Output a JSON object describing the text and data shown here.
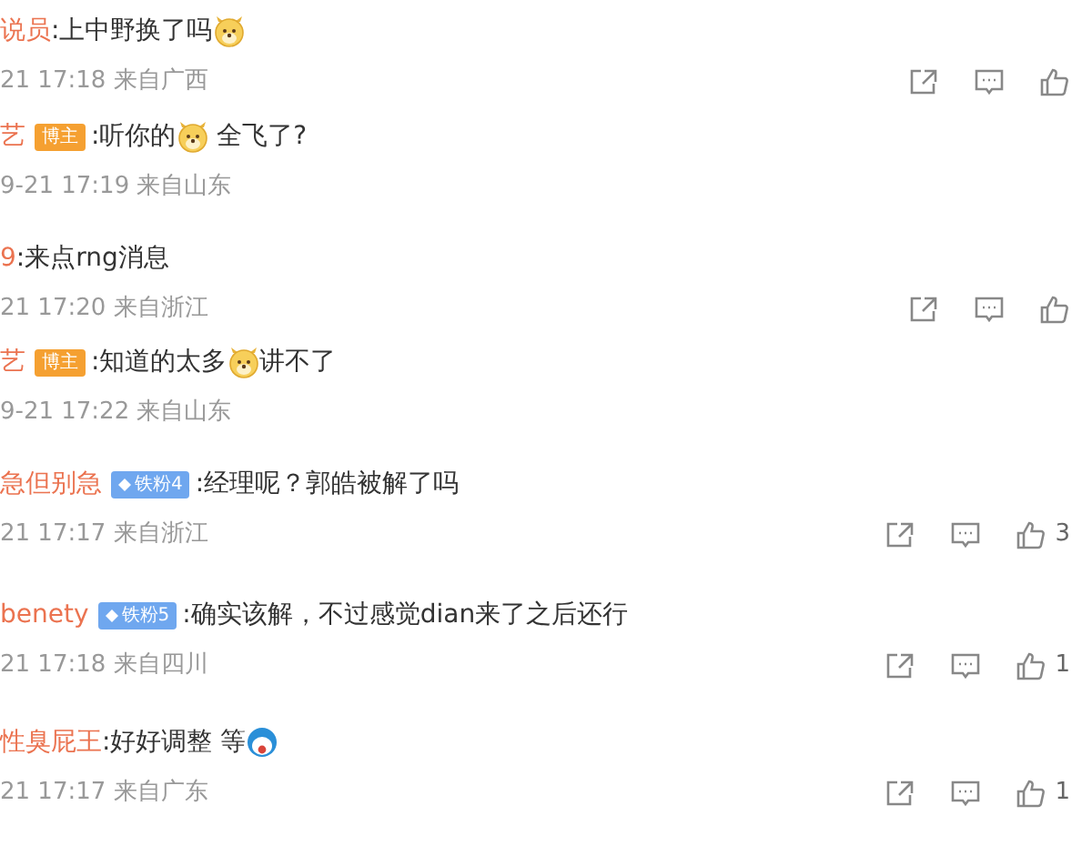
{
  "comments": [
    {
      "name": "说员",
      "parts": [
        {
          "kind": "text",
          "text": ":上中野换了吗"
        },
        {
          "kind": "dog_emoji"
        }
      ],
      "meta": "21 17:18 来自广西",
      "actions": true
    },
    {
      "name": "艺",
      "badge": {
        "kind": "author",
        "text": "博主"
      },
      "parts": [
        {
          "kind": "text",
          "text": ":听你的"
        },
        {
          "kind": "dog_emoji"
        },
        {
          "kind": "text",
          "text": " 全飞了?"
        }
      ],
      "meta": "9-21 17:19 来自山东",
      "actions": false
    },
    {
      "name": "9",
      "parts": [
        {
          "kind": "text",
          "text": ":来点rng消息"
        }
      ],
      "meta": "21 17:20 来自浙江",
      "actions": true
    },
    {
      "name": "艺",
      "badge": {
        "kind": "author",
        "text": "博主"
      },
      "parts": [
        {
          "kind": "text",
          "text": ":知道的太多"
        },
        {
          "kind": "dog_emoji"
        },
        {
          "kind": "text",
          "text": "讲不了"
        }
      ],
      "meta": "9-21 17:22 来自山东",
      "actions": false
    },
    {
      "name": "急但别急",
      "badge": {
        "kind": "fan",
        "text": "铁粉4"
      },
      "parts": [
        {
          "kind": "text",
          "text": ":经理呢？郭皓被解了吗"
        }
      ],
      "meta": "21 17:17 来自浙江",
      "actions": true,
      "likes": "3"
    },
    {
      "name": "benety",
      "badge": {
        "kind": "fan",
        "text": "铁粉5"
      },
      "parts": [
        {
          "kind": "text",
          "text": ":确实该解，不过感觉dian来了之后还行"
        }
      ],
      "meta": "21 17:18 来自四川",
      "actions": true,
      "likes": "1"
    },
    {
      "name": "性臭屁王",
      "parts": [
        {
          "kind": "text",
          "text": ":好好调整 等"
        },
        {
          "kind": "round_emoji"
        }
      ],
      "meta": "21 17:17 来自广东",
      "actions": true,
      "likes": "1"
    }
  ]
}
